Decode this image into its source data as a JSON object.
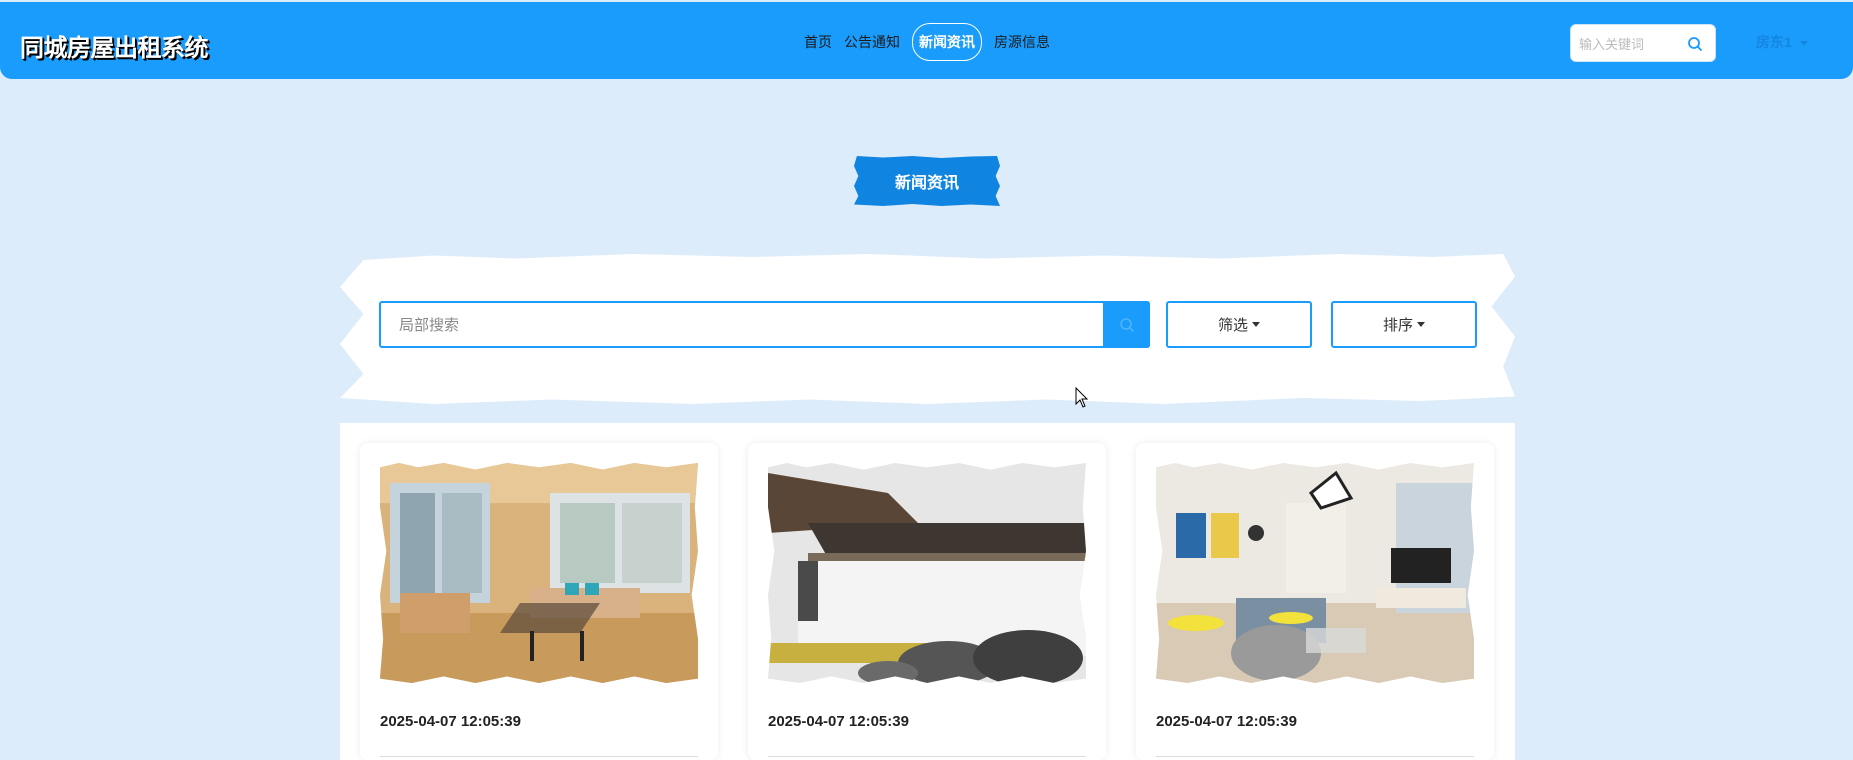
{
  "header": {
    "site_title": "同城房屋出租系统",
    "nav": [
      {
        "label": "首页",
        "active": false
      },
      {
        "label": "公告通知",
        "active": false
      },
      {
        "label": "新闻资讯",
        "active": true
      },
      {
        "label": "房源信息",
        "active": false
      }
    ],
    "search_placeholder": "输入关键词",
    "user_label": "房东1"
  },
  "section_title": "新闻资讯",
  "local_search": {
    "placeholder": "局部搜索",
    "filter_label": "筛选",
    "sort_label": "排序"
  },
  "cards": [
    {
      "date": "2025-04-07 12:05:39",
      "image": "living-room-photo"
    },
    {
      "date": "2025-04-07 12:05:39",
      "image": "chinese-courtyard-photo"
    },
    {
      "date": "2025-04-07 12:05:39",
      "image": "modern-living-room-photo"
    }
  ],
  "colors": {
    "primary": "#1a9cfc",
    "background": "#ddecfa",
    "title_badge": "#0f84e0"
  }
}
